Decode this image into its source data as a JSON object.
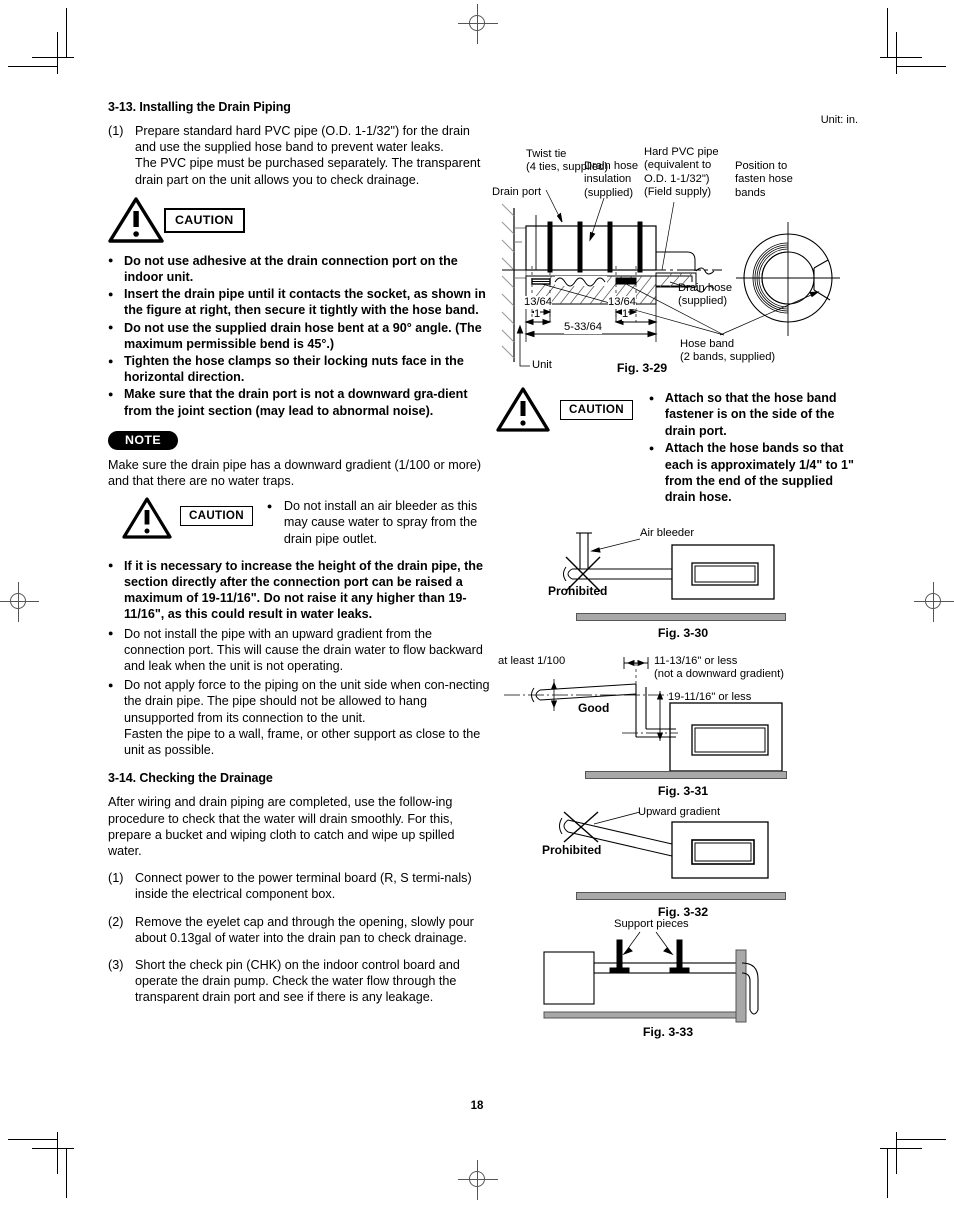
{
  "page": {
    "number": "18",
    "unit_note": "Unit: in."
  },
  "sections": {
    "s313": {
      "heading": "3-13.  Installing the Drain Piping",
      "item1_num": "(1)",
      "item1_text": "Prepare standard hard PVC pipe (O.D. 1-1/32\") for the drain and use the supplied hose band to prevent water leaks.",
      "item1_text2": "The PVC pipe must be purchased separately. The transparent drain part on the unit allows you to check drainage.",
      "caution_label": "CAUTION",
      "bullets": [
        "Do not use adhesive at the drain connection port on the indoor unit.",
        "Insert the drain pipe until it contacts the socket, as shown in the figure at right, then secure it tightly with the hose band.",
        "Do not use the supplied drain hose bent at a 90° angle. (The maximum permissible bend is 45°.)",
        "Tighten the hose clamps so their locking nuts face in the horizontal direction.",
        "Make sure that the drain port is not a downward gra-dient from the joint section (may lead to abnormal noise)."
      ],
      "note_label": "NOTE",
      "note_text": "Make sure the drain pipe has a downward gradient (1/100 or more) and that there are no water traps.",
      "caution2_label": "CAUTION",
      "caution2_bullets": [
        "Do not install an air bleeder as this may cause water to spray from the drain pipe outlet."
      ],
      "bullets2": [
        "If it is necessary to increase the height of the drain pipe, the section directly after the connection port can be raised a maximum of 19-11/16\". Do not raise it any higher than 19-11/16\", as this could result in water leaks.",
        "Do not install the pipe with an upward gradient from the connection port. This will cause the drain water to flow backward and leak when the unit is not operating.",
        "Do not apply force to the piping on the unit side when con-necting the drain pipe. The pipe should not be allowed to hang unsupported from its connection to the unit.\nFasten the pipe to a wall, frame, or other support as close to the unit as possible."
      ]
    },
    "s314": {
      "heading": "3-14.  Checking the Drainage",
      "intro": "After wiring and drain piping are completed, use the follow-ing procedure to check that the water will drain smoothly. For this, prepare a bucket and wiping cloth to catch and wipe up spilled water.",
      "steps": [
        {
          "num": "(1)",
          "text": "Connect power to the power terminal board (R, S termi-nals) inside the electrical component box."
        },
        {
          "num": "(2)",
          "text": "Remove the eyelet cap and through the opening, slowly pour about 0.13gal of water into the drain pan to check drainage."
        },
        {
          "num": "(3)",
          "text": "Short the check pin (CHK) on the indoor control board and operate the drain pump. Check the water flow through the transparent drain port and see if there is any leakage."
        }
      ]
    }
  },
  "right_caution": {
    "label": "CAUTION",
    "bullets": [
      "Attach so that the hose band fastener is on the side of the drain port.",
      "Attach the hose bands so that each is approximately 1/4\" to 1\" from the end of the supplied drain hose."
    ]
  },
  "figures": {
    "fig329": {
      "caption": "Fig. 3-29",
      "labels": {
        "twist_tie": "Twist tie\n(4 ties, supplied)",
        "drain_port": "Drain port",
        "drain_hose_insulation": "Drain hose\ninsulation\n(supplied)",
        "hard_pvc_pipe": "Hard PVC pipe\n(equivalent to\nO.D. 1-1/32\")\n(Field supply)",
        "position_fasten": "Position to\nfasten hose\nbands",
        "drain_hose": "Drain hose\n(supplied)",
        "hose_band": "Hose band\n(2 bands, supplied)",
        "unit": "Unit"
      },
      "dimensions": {
        "d1": "13/64",
        "d2": "1",
        "d3": "13/64",
        "d4": "1",
        "d5": "5-33/64"
      }
    },
    "fig330": {
      "caption": "Fig. 3-30",
      "labels": {
        "air_bleeder": "Air bleeder",
        "prohibited": "Prohibited"
      }
    },
    "fig331": {
      "caption": "Fig. 3-31",
      "labels": {
        "at_least": "at least 1/100",
        "top_dim": "11-13/16\" or less\n(not a downward gradient)",
        "side_dim": "19-11/16\" or less",
        "good": "Good"
      }
    },
    "fig332": {
      "caption": "Fig. 3-32",
      "labels": {
        "upward_gradient": "Upward gradient",
        "prohibited": "Prohibited"
      }
    },
    "fig333": {
      "caption": "Fig. 3-33",
      "labels": {
        "support_pieces": "Support pieces"
      }
    }
  },
  "colors": {
    "ink": "#000000",
    "floor_gray": "#a8a8a8",
    "reg_gray": "#555555"
  }
}
